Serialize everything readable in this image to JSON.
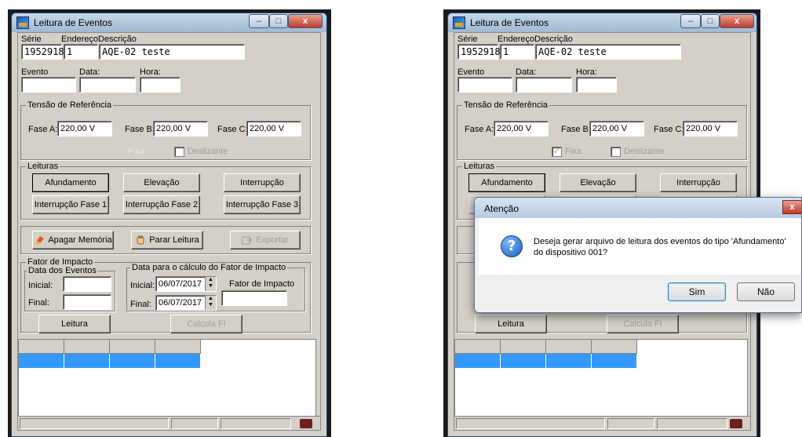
{
  "left": {
    "title": "Leitura de Eventos",
    "labels": {
      "serie": "Série",
      "endereco": "Endereço",
      "descricao": "Descrição",
      "evento": "Evento",
      "data": "Data:",
      "hora": "Hora:"
    },
    "values": {
      "serie": "1952918",
      "endereco": "1",
      "descricao": "AQE-02 teste",
      "evento": "",
      "data": "",
      "hora": ""
    },
    "tensao": {
      "legend": "Tensão de Referência",
      "fase_a_label": "Fase A:",
      "fase_a": "220,00 V",
      "fase_b_label": "Fase B:",
      "fase_b": "220,00 V",
      "fase_c_label": "Fase C:",
      "fase_c": "220,00 V",
      "fixa_label": "Fixa",
      "fixa_checked": false,
      "deslizante_label": "Deslizante",
      "deslizante_checked": false
    },
    "leituras": {
      "legend": "Leituras",
      "afundamento": "Afundamento",
      "elevacao": "Elevação",
      "interrupcao": "Interrupção",
      "int_fase1": "Interrupção Fase 1",
      "int_fase2": "Interrupção Fase 2",
      "int_fase3": "Interrupção Fase 3"
    },
    "actions": {
      "apagar": "Apagar Memória",
      "parar": "Parar Leitura",
      "exportar": "Exportar"
    },
    "fator": {
      "legend": "Fator de Impacto",
      "datas_legend": "Data dos Eventos",
      "inicial_label": "Inicial:",
      "final_label": "Final:",
      "inicial": "",
      "final": "",
      "calc_legend": "Data para o cálculo do Fator de Impacto",
      "calc_inicial": "06/07/2017",
      "calc_final": "06/07/2017",
      "fator_label": "Fator de Impacto",
      "fator_value": ""
    },
    "leitura_btn": "Leitura",
    "calcula_btn": "Calcula FI"
  },
  "right": {
    "title": "Leitura de Eventos",
    "labels": {
      "serie": "Série",
      "endereco": "Endereço",
      "descricao": "Descrição",
      "evento": "Evento",
      "data": "Data:",
      "hora": "Hora:"
    },
    "values": {
      "serie": "1952918",
      "endereco": "1",
      "descricao": "AQE-02 teste"
    },
    "tensao": {
      "legend": "Tensão de Referência",
      "fase_a_label": "Fase A:",
      "fase_a": "220,00 V",
      "fase_b_label": "Fase B:",
      "fase_b": "220,00 V",
      "fase_c_label": "Fase C:",
      "fase_c": "220,00 V",
      "fixa_label": "Fixa",
      "fixa_checked": true,
      "deslizante_label": "Deslizante"
    },
    "leituras": {
      "legend": "Leituras",
      "afundamento": "Afundamento",
      "elevacao": "Elevação",
      "interrupcao": "Interrupção"
    },
    "leitura_btn": "Leitura",
    "calcula_btn": "Calcula FI"
  },
  "dialog": {
    "title": "Atenção",
    "message": "Deseja gerar arquivo de leitura dos eventos do tipo 'Afundamento' do dispositivo 001?",
    "yes": "Sim",
    "no": "Não"
  }
}
